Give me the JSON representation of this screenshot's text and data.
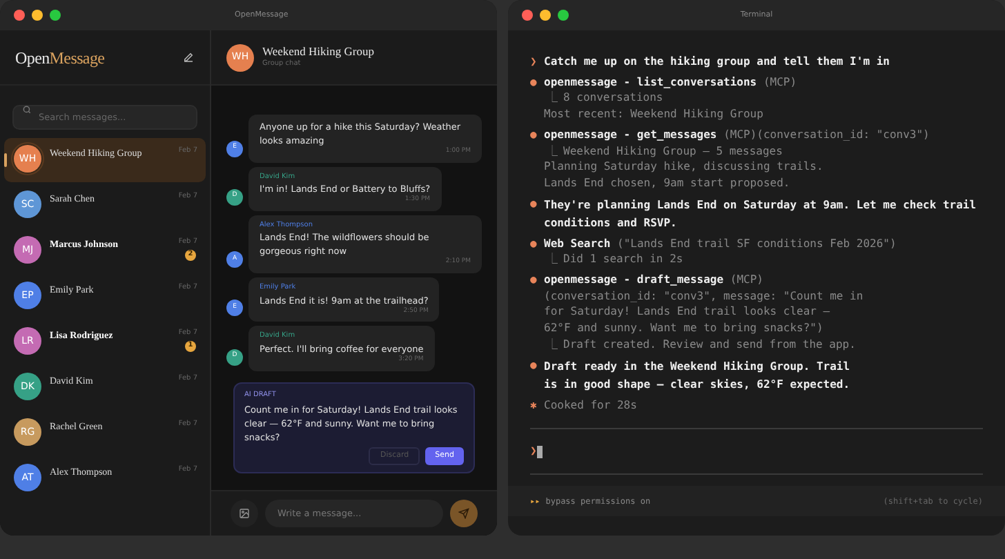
{
  "app_window": {
    "title": "OpenMessage",
    "logo": {
      "first": "Open",
      "second": "Message"
    },
    "search": {
      "placeholder": "Search messages..."
    },
    "conversations": [
      {
        "initials": "WH",
        "name": "Weekend Hiking Group",
        "date": "Feb 7",
        "color": "#e5804f",
        "selected": true
      },
      {
        "initials": "SC",
        "name": "Sarah Chen",
        "date": "Feb 7",
        "color": "#5e96d6",
        "selected": false
      },
      {
        "initials": "MJ",
        "name": "Marcus Johnson",
        "date": "Feb 7",
        "color": "#c46bb3",
        "selected": false,
        "unread": "2"
      },
      {
        "initials": "EP",
        "name": "Emily Park",
        "date": "Feb 7",
        "color": "#4f7fe6",
        "selected": false
      },
      {
        "initials": "LR",
        "name": "Lisa Rodriguez",
        "date": "Feb 7",
        "color": "#c46bb3",
        "selected": false,
        "unread": "1"
      },
      {
        "initials": "DK",
        "name": "David Kim",
        "date": "Feb 7",
        "color": "#36a186",
        "selected": false
      },
      {
        "initials": "RG",
        "name": "Rachel Green",
        "date": "Feb 7",
        "color": "#c79a5e",
        "selected": false
      },
      {
        "initials": "AT",
        "name": "Alex Thompson",
        "date": "Feb 7",
        "color": "#4f7fe6",
        "selected": false
      }
    ],
    "chat": {
      "initials": "WH",
      "color": "#e5804f",
      "title": "Weekend Hiking Group",
      "subtitle": "Group chat",
      "messages": [
        {
          "avatar": "E",
          "color": "#4f7fe6",
          "text": "Anyone up for a hike this Saturday? Weather looks amazing",
          "time": "1:00 PM"
        },
        {
          "avatar": "D",
          "color": "#36a186",
          "sender": "David Kim",
          "text": "I'm in! Lands End or Battery to Bluffs?",
          "time": "1:30 PM"
        },
        {
          "avatar": "A",
          "color": "#4f7fe6",
          "sender": "Alex Thompson",
          "text": "Lands End! The wildflowers should be gorgeous right now",
          "time": "2:10 PM"
        },
        {
          "avatar": "E",
          "color": "#4f7fe6",
          "sender": "Emily Park",
          "text": "Lands End it is! 9am at the trailhead?",
          "time": "2:50 PM"
        },
        {
          "avatar": "D",
          "color": "#36a186",
          "sender": "David Kim",
          "text": "Perfect. I'll bring coffee for everyone",
          "time": "3:20 PM"
        }
      ],
      "draft": {
        "label": "AI DRAFT",
        "text": "Count me in for Saturday! Lands End trail looks clear — 62°F and sunny. Want me to bring snacks?",
        "buttons": [
          "Discard",
          "Send"
        ]
      },
      "composer": {
        "placeholder": "Write a message..."
      }
    }
  },
  "terminal": {
    "title": "Terminal",
    "entries": [
      {
        "kind": "prompt",
        "mark": "❯",
        "text": "Catch me up on the hiking group and tell them I'm in"
      },
      {
        "kind": "tool",
        "mark": "●",
        "name": "openmessage - list_conversations",
        "suffix": "(MCP)",
        "result": "8 conversations",
        "result_mark": "⎿",
        "more": [
          "Most recent: Weekend Hiking Group"
        ]
      },
      {
        "kind": "tool",
        "mark": "●",
        "name": "openmessage - get_messages",
        "suffix": "(MCP)(conversation_id: \"conv3\")",
        "result": "Weekend Hiking Group — 5 messages",
        "result_mark": "⎿",
        "more": [
          "Planning Saturday hike, discussing trails.",
          "Lands End chosen, 9am start proposed."
        ]
      },
      {
        "kind": "message",
        "mark": "●",
        "lines": [
          "They're planning Lands End on Saturday at 9am. Let me check trail",
          "conditions and RSVP."
        ]
      },
      {
        "kind": "tool",
        "mark": "●",
        "name": "Web Search",
        "suffix": "(\"Lands End trail SF conditions Feb 2026\")",
        "result": "Did 1 search in 2s",
        "result_mark": "⎿"
      },
      {
        "kind": "tool",
        "mark": "●",
        "name": "openmessage - draft_message",
        "suffix": "(MCP)",
        "args": [
          "(conversation_id: \"conv3\", message: \"Count me in",
          "for Saturday! Lands End trail looks clear —",
          "62°F and sunny. Want me to bring snacks?\")"
        ],
        "result": "Draft created. Review and send from the app.",
        "result_mark": "⎿"
      },
      {
        "kind": "message",
        "mark": "●",
        "lines": [
          "Draft ready in the Weekend Hiking Group. Trail",
          "is in good shape — clear skies, 62°F expected."
        ]
      },
      {
        "kind": "status",
        "mark": "✱",
        "text": "Cooked for 28s"
      }
    ],
    "input": {
      "mark": "❯"
    },
    "footer": {
      "mark": "▸▸",
      "text": "bypass permissions on",
      "hint": "(shift+tab to cycle)"
    }
  }
}
